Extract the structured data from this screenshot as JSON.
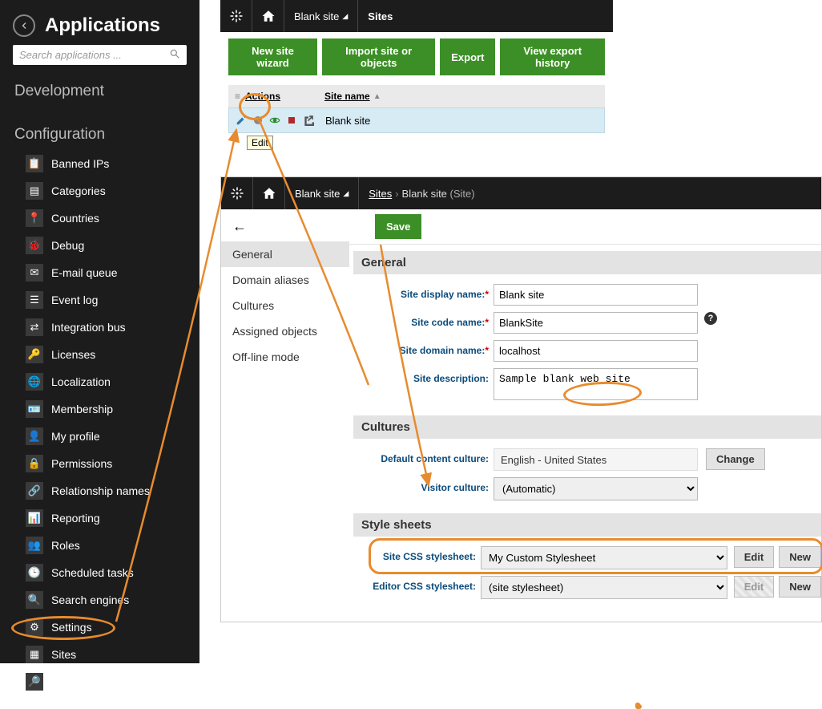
{
  "sidebar": {
    "title": "Applications",
    "searchPlaceholder": "Search applications ...",
    "cat1": "Development",
    "cat2": "Configuration",
    "items": [
      {
        "label": "Banned IPs"
      },
      {
        "label": "Categories"
      },
      {
        "label": "Countries"
      },
      {
        "label": "Debug"
      },
      {
        "label": "E-mail queue"
      },
      {
        "label": "Event log"
      },
      {
        "label": "Integration bus"
      },
      {
        "label": "Licenses"
      },
      {
        "label": "Localization"
      },
      {
        "label": "Membership"
      },
      {
        "label": "My profile"
      },
      {
        "label": "Permissions"
      },
      {
        "label": "Relationship names"
      },
      {
        "label": "Reporting"
      },
      {
        "label": "Roles"
      },
      {
        "label": "Scheduled tasks"
      },
      {
        "label": "Search engines"
      },
      {
        "label": "Settings"
      },
      {
        "label": "Sites"
      },
      {
        "label": "Smart search"
      }
    ]
  },
  "top": {
    "siteSel": "Blank site",
    "crumb": "Sites",
    "btn1": "New site wizard",
    "btn2": "Import site or objects",
    "btn3": "Export",
    "btn4": "View export history",
    "colActions": "Actions",
    "colName": "Site name",
    "rowName": "Blank site",
    "editTip": "Edit"
  },
  "bottom": {
    "siteSel": "Blank site",
    "crumbSites": "Sites",
    "crumbCurrent": "Blank site",
    "crumbType": "(Site)",
    "save": "Save",
    "tabs": [
      "General",
      "Domain aliases",
      "Cultures",
      "Assigned objects",
      "Off-line mode"
    ],
    "sec1": "General",
    "f1": "Site display name:",
    "f1v": "Blank site",
    "f2": "Site code name:",
    "f2v": "BlankSite",
    "f3": "Site domain name:",
    "f3v": "localhost",
    "f4": "Site description:",
    "f4v": "Sample blank web site",
    "sec2": "Cultures",
    "f5": "Default content culture:",
    "f5v": "English - United States",
    "change": "Change",
    "f6": "Visitor culture:",
    "f6v": "(Automatic)",
    "sec3": "Style sheets",
    "f7": "Site CSS stylesheet:",
    "f7v": "My Custom Stylesheet",
    "f8": "Editor CSS stylesheet:",
    "f8v": "(site stylesheet)",
    "edit": "Edit",
    "new": "New"
  }
}
